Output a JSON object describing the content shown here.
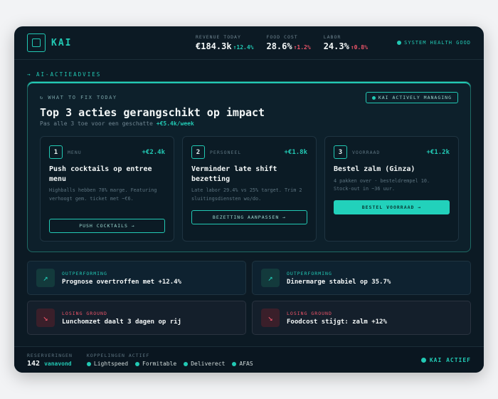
{
  "app": {
    "name": "KAI"
  },
  "metrics": [
    {
      "label": "REVENUE TODAY",
      "value": "€184.3k",
      "change": "↑12.4%",
      "trend": "good"
    },
    {
      "label": "FOOD COST",
      "value": "28.6%",
      "change": "↑1.2%",
      "trend": "bad"
    },
    {
      "label": "LABOR",
      "value": "24.3%",
      "change": "↑0.8%",
      "trend": "bad"
    }
  ],
  "system_health": "SYSTEM HEALTH GOOD",
  "section_label": "→ AI-ACTIEADVIES",
  "panel": {
    "kicker": "↻ WHAT TO FIX TODAY",
    "title": "Top 3 acties gerangschikt op impact",
    "subtitle_prefix": "Pas alle 3 toe voor een geschatte",
    "subtitle_value": "+€5.4k/week",
    "managing_badge": "KAI ACTIVELY MANAGING"
  },
  "actions": [
    {
      "number": "1",
      "category": "MENU",
      "impact": "+€2.4k",
      "title": "Push cocktails op entree menu",
      "description": "Highballs hebben 78% marge. Featuring verhoogt gem. ticket met ~€6.",
      "button": "PUSH COCKTAILS →",
      "primary": false
    },
    {
      "number": "2",
      "category": "PERSONEEL",
      "impact": "+€1.8k",
      "title": "Verminder late shift bezetting",
      "description": "Late labor 29.4% vs 25% target. Trim 2 sluitingsdiensten wo/do.",
      "button": "BEZETTING AANPASSEN →",
      "primary": false
    },
    {
      "number": "3",
      "category": "VOORRAAD",
      "impact": "+€1.2k",
      "title": "Bestel zalm (Ginza)",
      "description": "4 pakken over · besteldrempel 10. Stock-out in ~36 uur.",
      "button": "BESTEL VOORRAAD →",
      "primary": true
    }
  ],
  "insights": [
    {
      "tag": "OUTPERFORMING",
      "message": "Prognose overtroffen met +12.4%",
      "icon": "↗",
      "kind": "pos"
    },
    {
      "tag": "OUTPERFORMING",
      "message": "Dinermarge stabiel op 35.7%",
      "icon": "↗",
      "kind": "pos"
    },
    {
      "tag": "LOSING GROUND",
      "message": "Lunchomzet daalt 3 dagen op rij",
      "icon": "↘",
      "kind": "neg"
    },
    {
      "tag": "LOSING GROUND",
      "message": "Foodcost stijgt: zalm +12%",
      "icon": "↘",
      "kind": "neg"
    }
  ],
  "footer": {
    "reservations_label": "RESERVERINGEN",
    "reservations_count": "142",
    "reservations_period": "vanavond",
    "integrations_label": "KOPPELINGEN ACTIEF",
    "integrations": [
      "Lightspeed",
      "Formitable",
      "Deliverect",
      "AFAS"
    ],
    "status": "KAI ACTIEF"
  },
  "colors": {
    "accent": "#22c9b4",
    "negative": "#f0556a",
    "background": "#0c1a24"
  }
}
